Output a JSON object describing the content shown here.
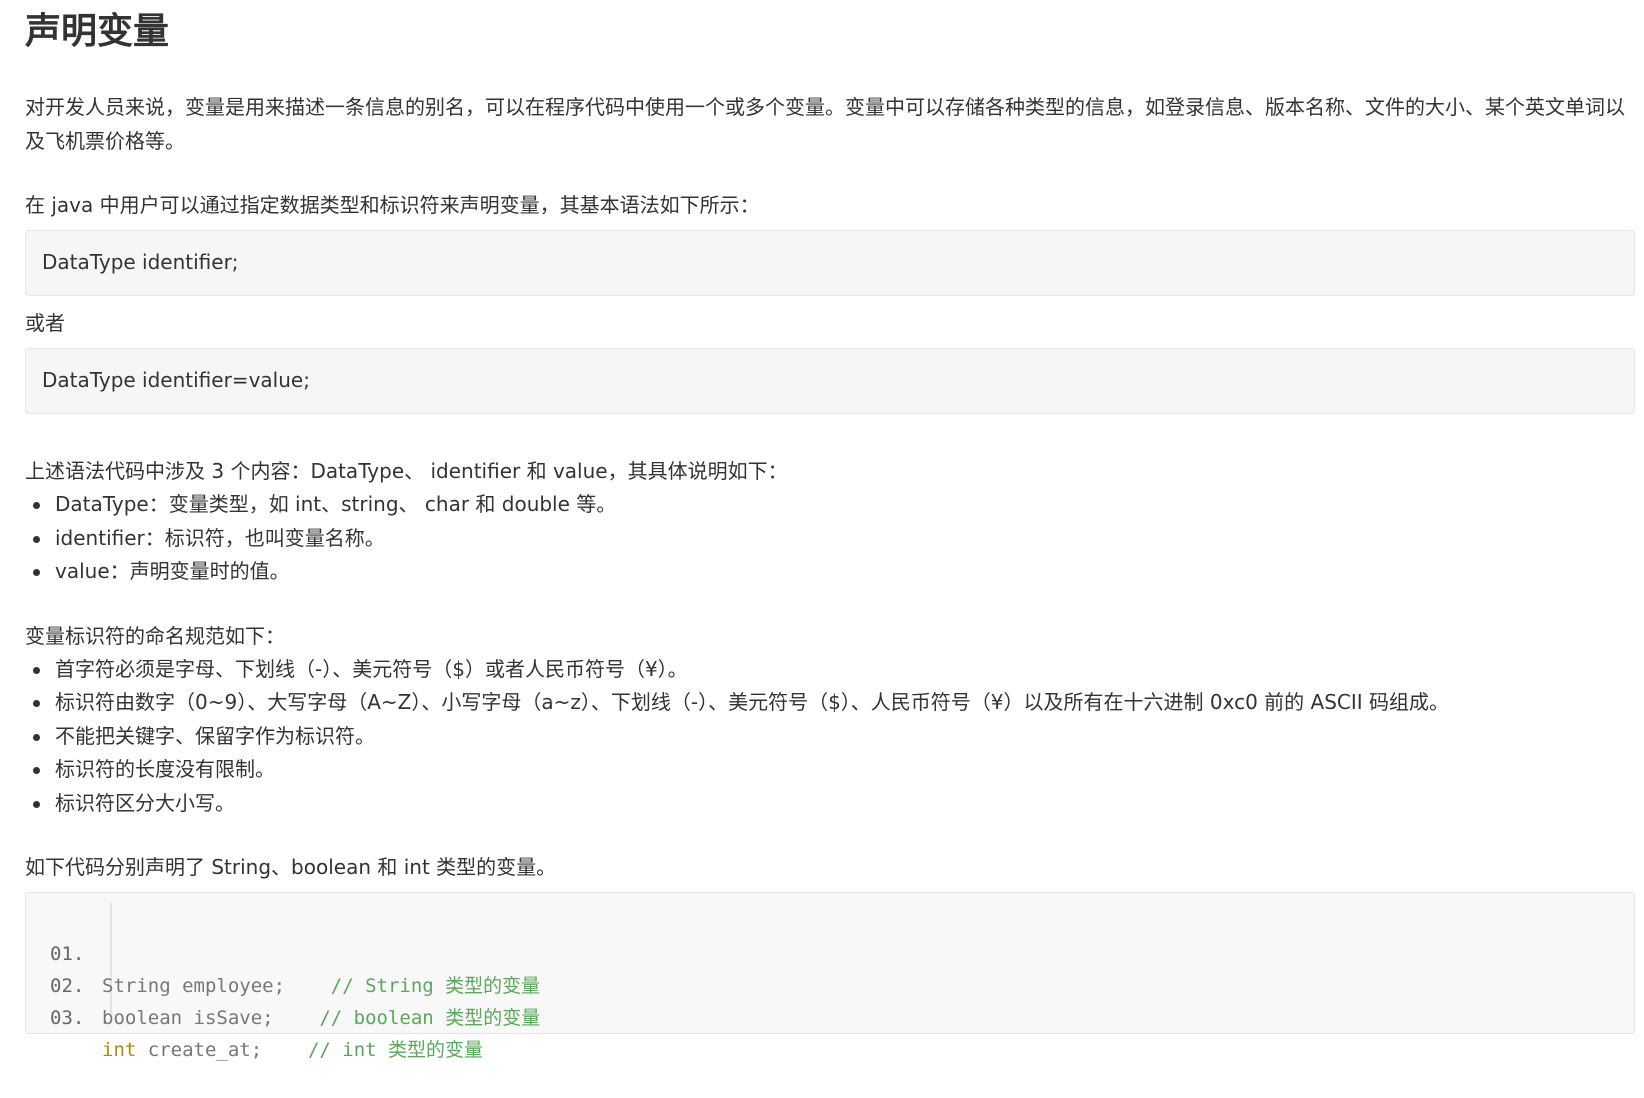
{
  "title": "声明变量",
  "intro": "对开发人员来说，变量是用来描述一条信息的别名，可以在程序代码中使用一个或多个变量。变量中可以存储各种类型的信息，如登录信息、版本名称、文件的大小、某个英文单词以及飞机票价格等。",
  "syntax_intro": "在 java 中用户可以通过指定数据类型和标识符来声明变量，其基本语法如下所示：",
  "syntax1": "DataType identifier;",
  "or_text": "或者",
  "syntax2": "DataType identifier=value;",
  "explain_intro": "上述语法代码中涉及 3 个内容：DataType、 identifier 和 value，其具体说明如下：",
  "explain_items": [
    "DataType：变量类型，如 int、string、 char 和 double 等。",
    "identifier：标识符，也叫变量名称。",
    "value：声明变量时的值。"
  ],
  "naming_intro": "变量标识符的命名规范如下：",
  "naming_items": [
    "首字符必须是字母、下划线（-）、美元符号（$）或者人民币符号（¥）。",
    "标识符由数字（0~9）、大写字母（A~Z）、小写字母（a~z）、下划线（-）、美元符号（$）、人民币符号（¥）以及所有在十六进制 0xc0 前的 ASCII 码组成。",
    "不能把关键字、保留字作为标识符。",
    "标识符的长度没有限制。",
    "标识符区分大小写。"
  ],
  "example_intro": "如下代码分别声明了 String、boolean 和 int 类型的变量。",
  "code_lines": [
    {
      "num": "01.",
      "code": "String employee;",
      "keyword": "",
      "comment": "// String 类型的变量"
    },
    {
      "num": "02.",
      "code": "boolean isSave;",
      "keyword": "",
      "comment": "// boolean 类型的变量"
    },
    {
      "num": "03.",
      "code": " create_at;",
      "keyword": "int",
      "comment": "// int 类型的变量"
    }
  ]
}
